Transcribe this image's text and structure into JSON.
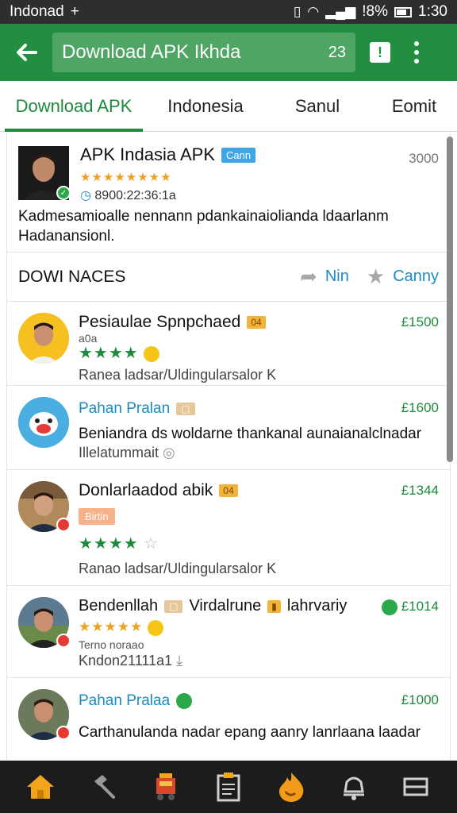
{
  "status_bar": {
    "carrier": "Indonad",
    "plus": "+",
    "battery_text": "!8%",
    "time": "1:30"
  },
  "toolbar": {
    "back_icon": "back-arrow-icon",
    "search_text": "Download APK Ikhda",
    "search_count": "23"
  },
  "tabs": [
    "Download APK",
    "Indonesia",
    "Sanul",
    "Eomit"
  ],
  "featured": {
    "title": "APK Indasia APK",
    "tag": "Cann",
    "stars": "★★★★★★★★",
    "meta": "8900:22:36:1a",
    "price": "3000",
    "description": "Kadmesamioalle nennann pdankainaiolianda ldaarlanm Hadanansionl."
  },
  "section": {
    "title": "DOWI NACES",
    "action_one": "Nin",
    "action_two": "Canny"
  },
  "apps": [
    {
      "title": "Pesiaulae Spnpchaed",
      "tag": "04",
      "price": "£1500",
      "caption": "a0a",
      "stars": "★★★★",
      "subtitle": "Ranea ladsar/Uldingularsalor K"
    },
    {
      "title": "Pahan Pralan",
      "tag": "",
      "price": "£1600",
      "line_one": "Beniandra ds woldarne thankanal aunaianalclnadar",
      "line_two": "Illelatummait"
    },
    {
      "title": "Donlarlaadod abik",
      "tag": "04",
      "price": "£1344",
      "badge": "Birtin",
      "stars": "★★★★",
      "subtitle": "Ranao ladsar/Uldingularsalor K"
    },
    {
      "title": "Bendenllah",
      "title_extra": "Virdalrune",
      "title_extra_two": "lahrvariy",
      "price": "£1014",
      "stars": "★★★★★",
      "caption": "Terno noraao",
      "subtitle": "Kndon21111a1"
    },
    {
      "title": "Pahan Pralaa",
      "price": "£1000",
      "line_one": "Carthanulanda nadar epang aanry lanrlaana laadar"
    }
  ],
  "bottom_nav": [
    "home-icon",
    "hammer-icon",
    "fire-truck-icon",
    "clipboard-icon",
    "flame-icon",
    "bell-icon",
    "menu-icon"
  ],
  "colors": {
    "brand_green": "#218f3f",
    "accent_blue": "#1e8bc3",
    "star_orange": "#f0a020"
  }
}
